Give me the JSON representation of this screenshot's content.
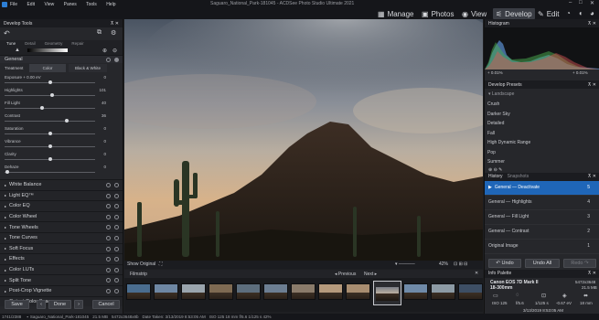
{
  "titlebar": {
    "title": "Saguaro_National_Park-181045 - ACDSee Photo Studio Ultimate 2021",
    "menu": [
      "File",
      "Edit",
      "View",
      "Panes",
      "Tools",
      "Help"
    ]
  },
  "modes": [
    {
      "label": "Manage",
      "icon": "manage-icon",
      "active": false
    },
    {
      "label": "Photos",
      "icon": "photos-icon",
      "active": false
    },
    {
      "label": "View",
      "icon": "view-icon",
      "active": false
    },
    {
      "label": "Develop",
      "icon": "develop-icon",
      "active": true
    },
    {
      "label": "Edit",
      "icon": "edit-icon",
      "active": false
    }
  ],
  "left": {
    "panel_title": "Develop Tools",
    "tabs": [
      "Tune",
      "Detail",
      "Geometry",
      "Repair"
    ],
    "general_label": "General",
    "treatment_label": "Treatment",
    "treatment_color": "Color",
    "treatment_bw": "Black & White",
    "sliders": [
      {
        "label": "Exposure + 0.00 eV",
        "value": "0",
        "pos": 0.5
      },
      {
        "label": "Highlights",
        "value": "101",
        "pos": 0.52
      },
      {
        "label": "Fill Light",
        "value": "40",
        "pos": 0.41
      },
      {
        "label": "Contrast",
        "value": "36",
        "pos": 0.68
      },
      {
        "label": "Saturation",
        "value": "0",
        "pos": 0.5
      },
      {
        "label": "Vibrance",
        "value": "0",
        "pos": 0.5
      },
      {
        "label": "Clarity",
        "value": "0",
        "pos": 0.5
      },
      {
        "label": "Dehaze",
        "value": "0",
        "pos": 0.03
      }
    ],
    "sections": [
      "White Balance",
      "Light EQ™",
      "Color EQ",
      "Color Wheel",
      "Tone Wheels",
      "Tone Curves",
      "Soft Focus",
      "Effects",
      "Color LUTs",
      "Split Tone",
      "Post-Crop Vignette",
      "Output Color Space"
    ],
    "save": "Save",
    "done": "Done",
    "cancel": "Cancel"
  },
  "viewer": {
    "show_original": "Show Original",
    "zoom": "42%",
    "filmstrip_label": "Filmstrip",
    "previous": "Previous",
    "next": "Next"
  },
  "right": {
    "histogram_title": "Histogram",
    "hist_left_value": "+ 0.01%",
    "hist_right_value": "+ 0.01%",
    "presets_title": "Develop Presets",
    "preset_group": "Landscape",
    "presets": [
      "Crush",
      "Darker Sky",
      "Detailed",
      "Fall",
      "High Dynamic Range",
      "Pop",
      "Summer"
    ],
    "history_tab": "History",
    "snapshots_tab": "Snapshots",
    "history": [
      {
        "label": "General — Deactivate",
        "n": "5",
        "active": true
      },
      {
        "label": "General — Highlights",
        "n": "4",
        "active": false
      },
      {
        "label": "General — Fill Light",
        "n": "3",
        "active": false
      },
      {
        "label": "General — Contrast",
        "n": "2",
        "active": false
      },
      {
        "label": "Original Image",
        "n": "1",
        "active": false
      }
    ],
    "undo": "Undo",
    "undo_all": "Undo All",
    "redo": "Redo",
    "info_title": "Info Palette",
    "camera": "Canon EOS 7D Mark II",
    "lens": "18-300mm",
    "resolution": "5472x3648",
    "filesize": "21.5 MB",
    "iso": "ISO 125",
    "aperture": "f/5.6",
    "shutter": "1/125 s",
    "ev": "-0.67 eV",
    "focal": "18 mm",
    "datetime": "3/13/2019 8:53:05 AM"
  },
  "status": {
    "index": "1741/2388",
    "filename": "Saguaro_National_Park-181045",
    "size": "21.5 MB",
    "dims": "5472x3648x8b",
    "date": "Date Taken: 3/13/2019 8:53:05 AM",
    "exif": "ISO 125   18 mm   f/5.6   1/125 s   42%"
  },
  "colors": {
    "accent": "#1f66b8",
    "panel": "#26272b",
    "bg": "#1e1f22"
  }
}
